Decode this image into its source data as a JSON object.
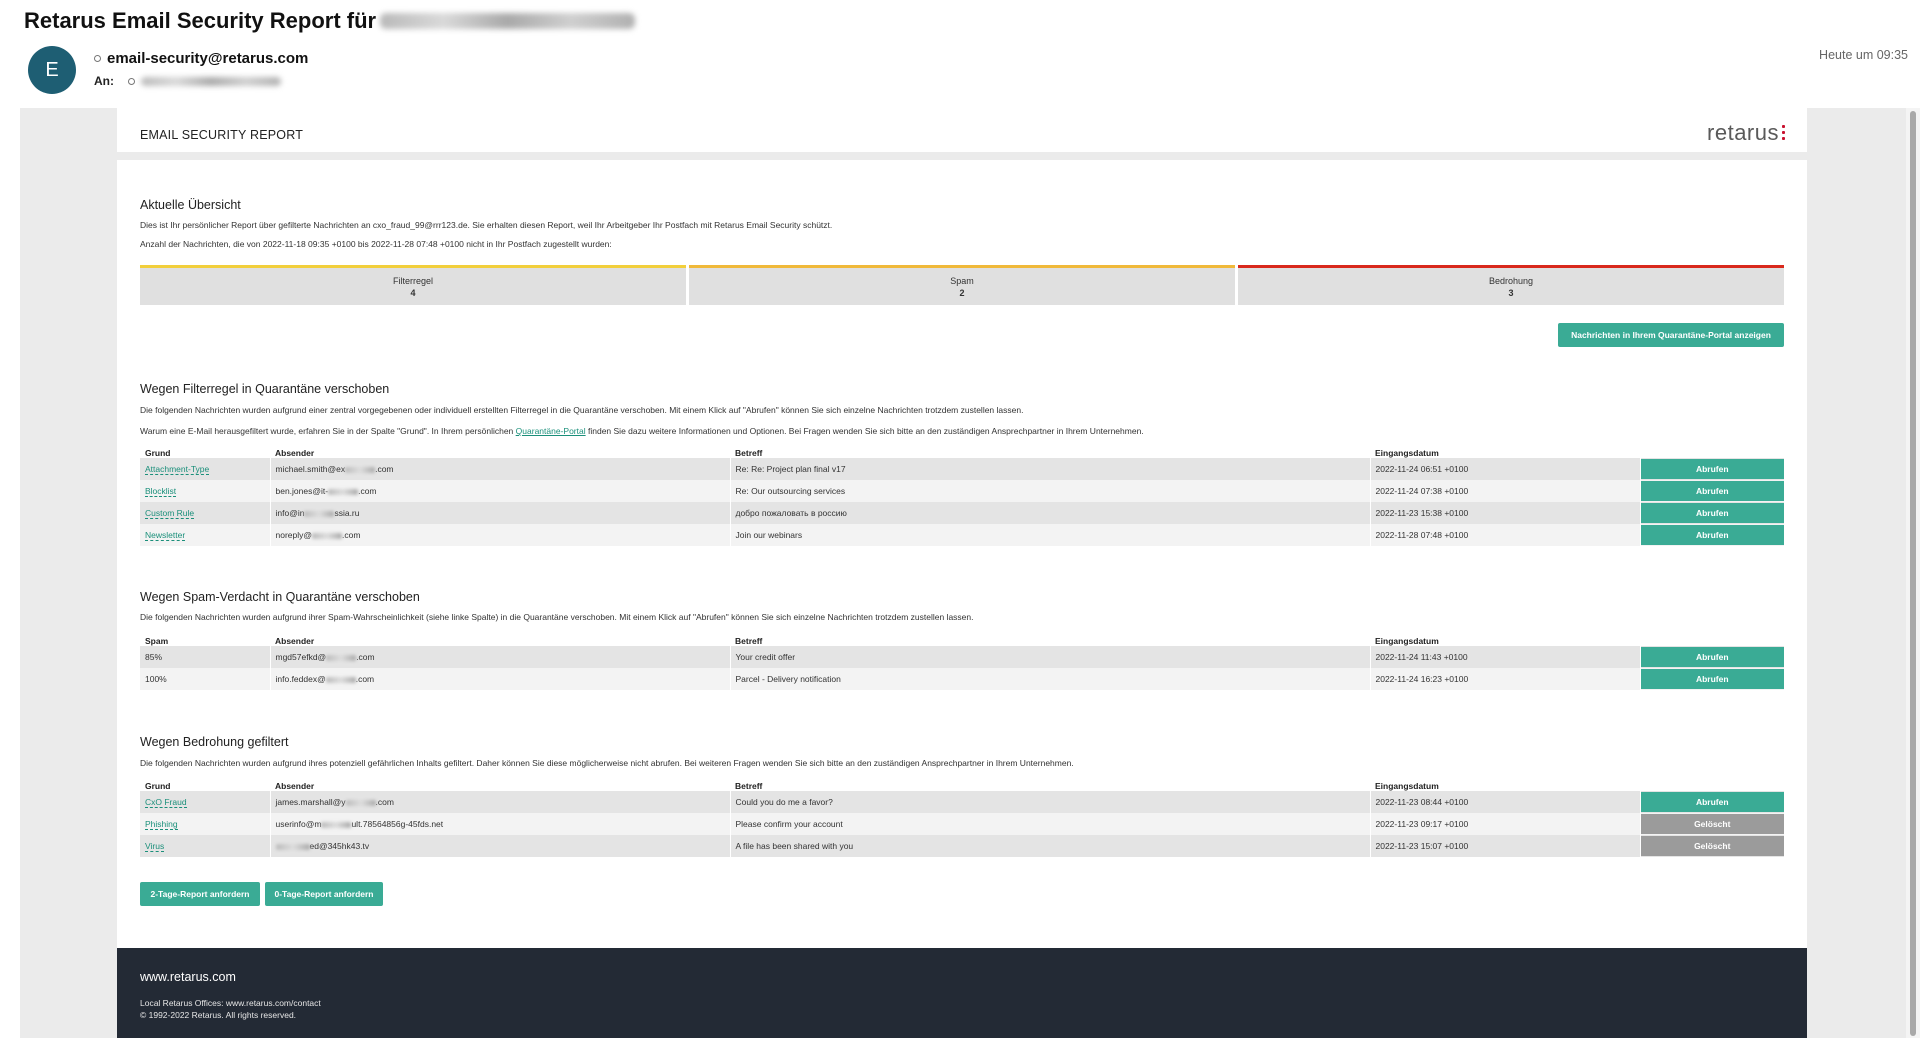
{
  "mail": {
    "subject": "Retarus Email Security Report für",
    "avatar_letter": "E",
    "sender": "email-security@retarus.com",
    "to_label": "An:",
    "time": "Heute um 09:35"
  },
  "report": {
    "title": "EMAIL SECURITY REPORT",
    "logo": "retarus",
    "overview": {
      "heading": "Aktuelle Übersicht",
      "line1": "Dies ist Ihr persönlicher Report über gefilterte Nachrichten an cxo_fraud_99@rrr123.de. Sie erhalten diesen Report, weil Ihr Arbeitgeber Ihr Postfach mit Retarus Email Security schützt.",
      "line2": "Anzahl der Nachrichten, die von 2022-11-18 09:35 +0100 bis 2022-11-28 07:48 +0100 nicht in Ihr Postfach zugestellt wurden:",
      "stats": [
        {
          "label": "Filterregel",
          "count": "4",
          "color": "#f2cf3b"
        },
        {
          "label": "Spam",
          "count": "2",
          "color": "#f0b93a"
        },
        {
          "label": "Bedrohung",
          "count": "3",
          "color": "#d9291c"
        }
      ],
      "portal_button": "Nachrichten in Ihrem Quarantäne-Portal anzeigen"
    },
    "filter": {
      "heading": "Wegen Filterregel in Quarantäne verschoben",
      "line1": "Die folgenden Nachrichten wurden aufgrund einer zentral vorgegebenen oder individuell erstellten Filterregel in die Quarantäne verschoben. Mit einem Klick auf \"Abrufen\" können Sie sich einzelne Nachrichten trotzdem zustellen lassen.",
      "line2_pre": "Warum eine E-Mail herausgefiltert wurde, erfahren Sie in der Spalte \"Grund\". In Ihrem persönlichen",
      "line2_link": "Quarantäne-Portal",
      "line2_post": "finden Sie dazu weitere Informationen und Optionen. Bei Fragen wenden Sie sich bitte an den zuständigen Ansprechpartner in Ihrem Unternehmen.",
      "headers": [
        "Grund",
        "Absender",
        "Betreff",
        "Eingangsdatum"
      ],
      "rows": [
        {
          "reason": "Attachment-Type",
          "sender_a": "michael.smith@ex",
          "sender_b": ".com",
          "subject": "Re: Re: Project plan final v17",
          "date": "2022-11-24 06:51 +0100",
          "action": "Abrufen"
        },
        {
          "reason": "Blocklist",
          "sender_a": "ben.jones@it-",
          "sender_b": ".com",
          "subject": "Re: Our outsourcing services",
          "date": "2022-11-24 07:38 +0100",
          "action": "Abrufen"
        },
        {
          "reason": "Custom Rule",
          "sender_a": "info@in",
          "sender_b": "ssia.ru",
          "subject": "добро пожаловать в россию",
          "date": "2022-11-23 15:38 +0100",
          "action": "Abrufen"
        },
        {
          "reason": "Newsletter",
          "sender_a": "noreply@",
          "sender_b": ".com",
          "subject": "Join our webinars",
          "date": "2022-11-28 07:48 +0100",
          "action": "Abrufen"
        }
      ]
    },
    "spam": {
      "heading": "Wegen Spam-Verdacht in Quarantäne verschoben",
      "line1": "Die folgenden Nachrichten wurden aufgrund ihrer Spam-Wahrscheinlichkeit (siehe linke Spalte) in die Quarantäne verschoben. Mit einem Klick auf \"Abrufen\" können Sie sich einzelne Nachrichten trotzdem zustellen lassen.",
      "headers": [
        "Spam",
        "Absender",
        "Betreff",
        "Eingangsdatum"
      ],
      "rows": [
        {
          "reason": "85%",
          "sender_a": "mgd57efkd@",
          "sender_b": ".com",
          "subject": "Your credit offer",
          "date": "2022-11-24 11:43 +0100",
          "action": "Abrufen"
        },
        {
          "reason": "100%",
          "sender_a": "info.feddex@",
          "sender_b": ".com",
          "subject": "Parcel - Delivery notification",
          "date": "2022-11-24 16:23 +0100",
          "action": "Abrufen"
        }
      ]
    },
    "threat": {
      "heading": "Wegen Bedrohung gefiltert",
      "line1": "Die folgenden Nachrichten wurden aufgrund ihres potenziell gefährlichen Inhalts gefiltert. Daher können Sie diese möglicherweise nicht abrufen. Bei weiteren Fragen wenden Sie sich bitte an den zuständigen Ansprechpartner in Ihrem Unternehmen.",
      "headers": [
        "Grund",
        "Absender",
        "Betreff",
        "Eingangsdatum"
      ],
      "rows": [
        {
          "reason": "CxO Fraud",
          "sender_a": "james.marshall@y",
          "sender_b": ".com",
          "subject": "Could you do me a favor?",
          "date": "2022-11-23 08:44 +0100",
          "action": "Abrufen"
        },
        {
          "reason": "Phishing",
          "sender_a": "userinfo@m",
          "sender_b": "ult.78564856g-45fds.net",
          "subject": "Please confirm your account",
          "date": "2022-11-23 09:17 +0100",
          "action": "Gelöscht"
        },
        {
          "reason": "Virus",
          "sender_a": "",
          "sender_b": "ed@345hk43.tv",
          "subject": "A file has been shared with you",
          "date": "2022-11-23 15:07 +0100",
          "action": "Gelöscht"
        }
      ]
    },
    "request_2day": "2-Tage-Report anfordern",
    "request_0day": "0-Tage-Report anfordern",
    "footer": {
      "site": "www.retarus.com",
      "offices": "Local Retarus Offices: www.retarus.com/contact",
      "copyright": "© 1992-2022 Retarus. All rights reserved."
    }
  }
}
